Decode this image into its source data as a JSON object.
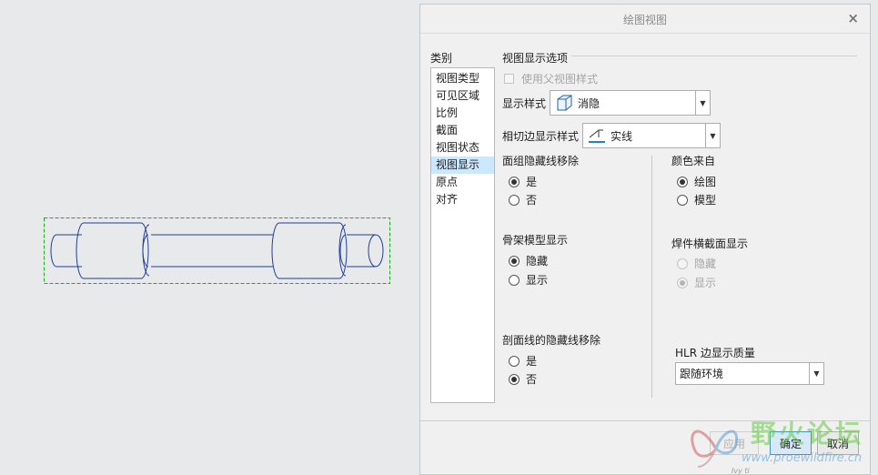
{
  "dialog": {
    "title": "绘图视图",
    "close_label": "×",
    "categories_label": "类别",
    "categories": [
      "视图类型",
      "可见区域",
      "比例",
      "截面",
      "视图状态",
      "视图显示",
      "原点",
      "对齐"
    ],
    "selected_category": "视图显示",
    "section_title": "视图显示选项",
    "use_parent_style_label": "使用父视图样式",
    "display_style": {
      "label": "显示样式",
      "value": "消隐",
      "icon": "hidden-line-cube-icon"
    },
    "tangent_edge_style": {
      "label": "相切边显示样式",
      "value": "实线",
      "icon": "tangent-edge-icon"
    },
    "face_hidden_line_removal": {
      "label": "面组隐藏线移除",
      "options": [
        "是",
        "否"
      ],
      "selected": "是"
    },
    "color_from": {
      "label": "颜色来自",
      "options": [
        "绘图",
        "模型"
      ],
      "selected": "绘图"
    },
    "skeleton_display": {
      "label": "骨架模型显示",
      "options": [
        "隐藏",
        "显示"
      ],
      "selected": "隐藏"
    },
    "weld_section_display": {
      "label": "焊件横截面显示",
      "options": [
        "隐藏",
        "显示"
      ],
      "selected": "显示",
      "disabled": true
    },
    "xhatch_hidden_line_removal": {
      "label": "剖面线的隐藏线移除",
      "options": [
        "是",
        "否"
      ],
      "selected": "否"
    },
    "hlr_edge_quality": {
      "label": "HLR 边显示质量",
      "value": "跟随环境"
    },
    "buttons": {
      "apply": "应用",
      "ok": "确定",
      "cancel": "取消"
    }
  },
  "watermark": {
    "text": "野火论坛",
    "url": "www.proewildfire.cn",
    "signature": "Ivy ti"
  },
  "colors": {
    "model_edge": "#1f3f9a",
    "view_box": "#22aa22",
    "selection": "#cce8ff",
    "primary_border": "#4a90d9"
  }
}
